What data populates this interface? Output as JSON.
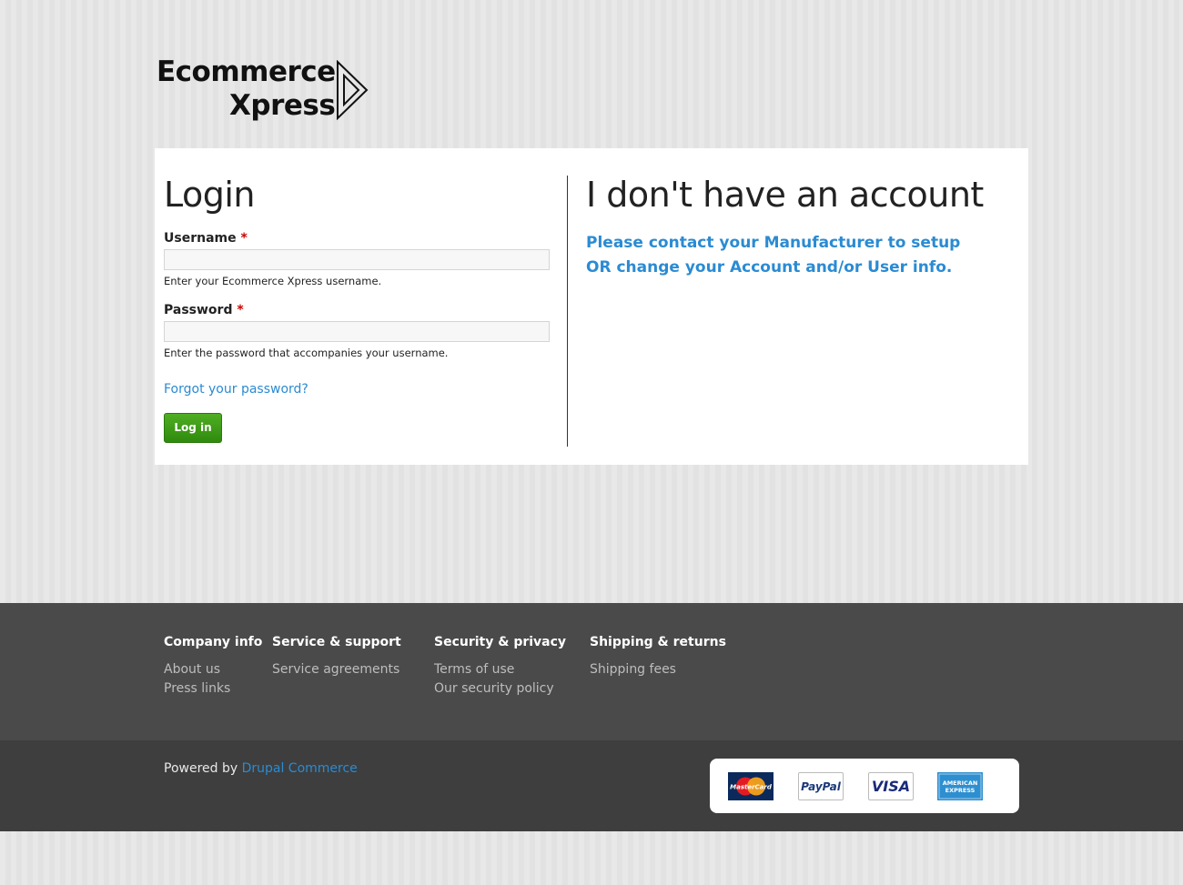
{
  "brand": {
    "line1": "Ecommerce",
    "line2": "Xpress"
  },
  "login": {
    "title": "Login",
    "username_label": "Username",
    "username_value": "",
    "username_help": "Enter your Ecommerce Xpress username.",
    "password_label": "Password",
    "password_value": "",
    "password_help": "Enter the password that accompanies your username.",
    "required_marker": "*",
    "forgot_link": "Forgot your password?",
    "submit_label": "Log in"
  },
  "no_account": {
    "title": "I don't have an account",
    "message": "Please contact your Manufacturer to setup OR change your Account and/or User info."
  },
  "footer": {
    "columns": [
      {
        "heading": "Company info",
        "links": [
          "About us",
          "Press links"
        ]
      },
      {
        "heading": "Service & support",
        "links": [
          "Service agreements"
        ]
      },
      {
        "heading": "Security & privacy",
        "links": [
          "Terms of use",
          "Our security policy"
        ]
      },
      {
        "heading": "Shipping & returns",
        "links": [
          "Shipping fees"
        ]
      }
    ],
    "powered_prefix": "Powered by ",
    "powered_link": "Drupal Commerce",
    "payment_methods": [
      {
        "name": "mastercard-icon",
        "label": "MasterCard"
      },
      {
        "name": "paypal-icon",
        "label": "PayPal"
      },
      {
        "name": "visa-icon",
        "label": "VISA"
      },
      {
        "name": "amex-icon",
        "label": "AMERICAN EXPRESS"
      }
    ]
  },
  "colors": {
    "link": "#2a8bd3",
    "button": "#3a9a15",
    "required": "#cc0000",
    "footer_top": "#4a4a4a",
    "footer_bottom": "#3e3e3e"
  }
}
